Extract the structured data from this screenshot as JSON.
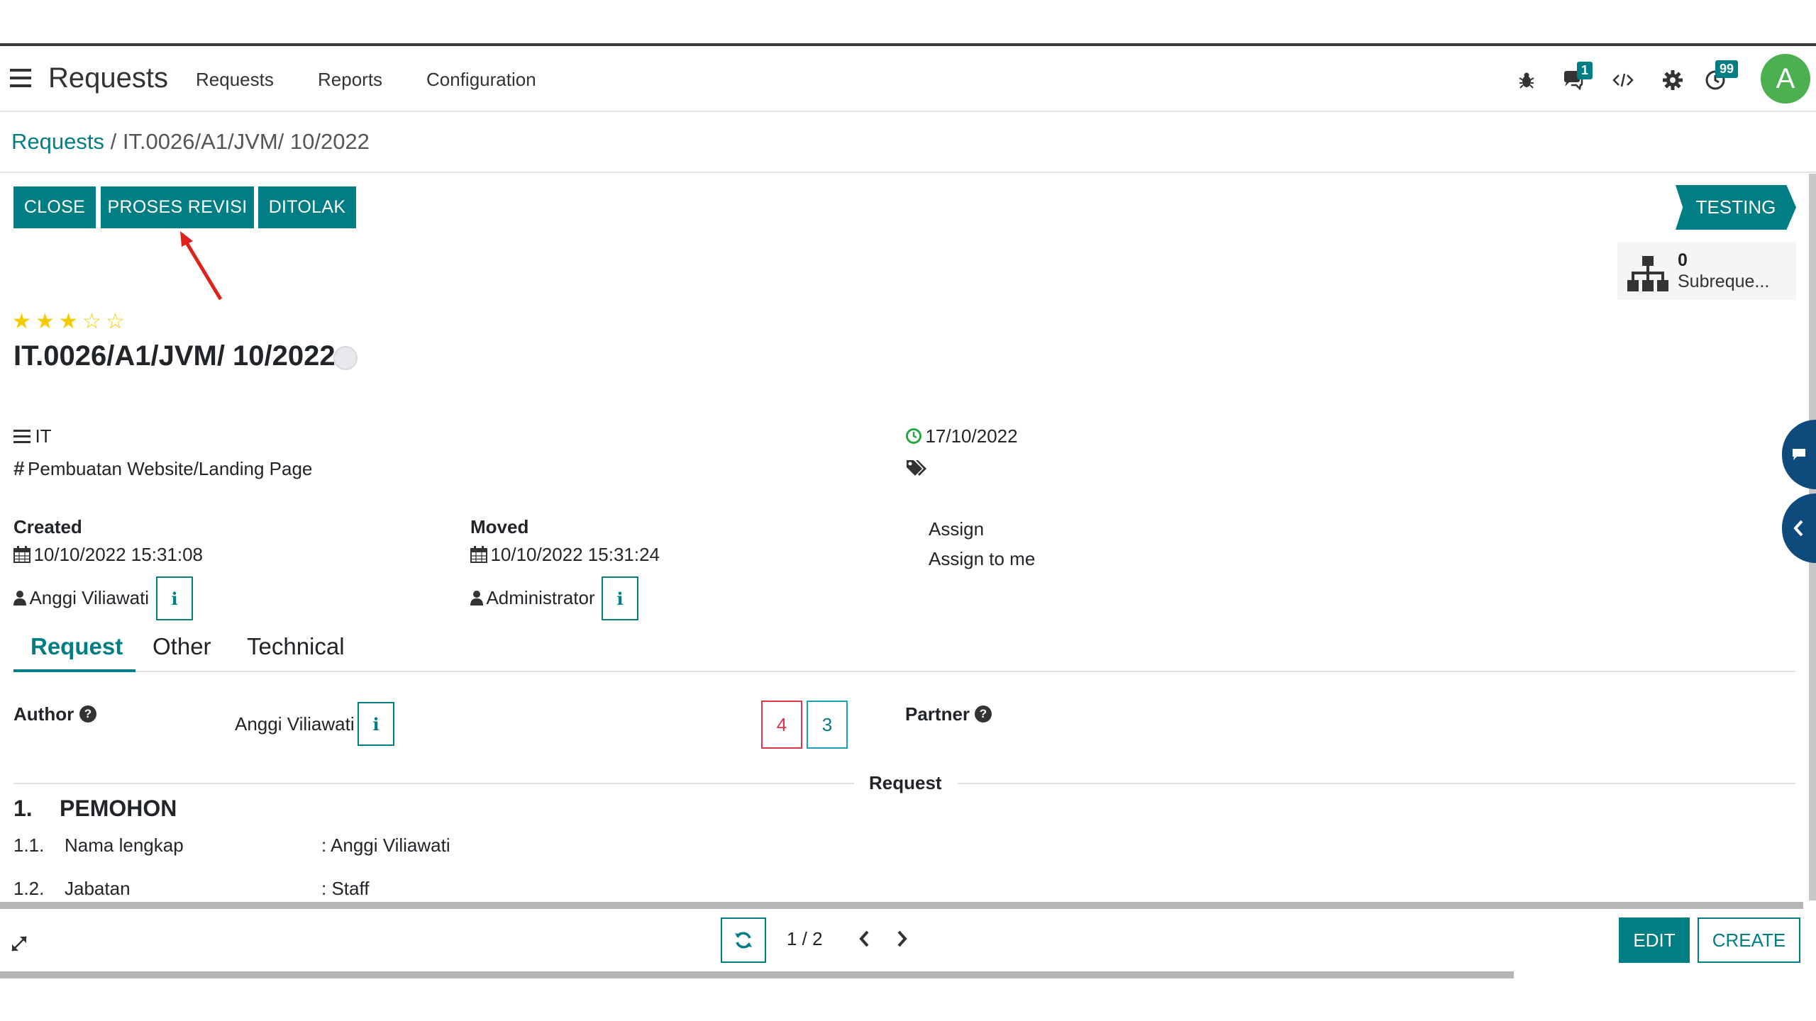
{
  "navbar": {
    "app_title": "Requests",
    "menu": [
      "Requests",
      "Reports",
      "Configuration"
    ],
    "chat_badge": "1",
    "activity_badge": "99",
    "avatar_letter": "A",
    "icons": [
      "menu-icon",
      "bug-icon",
      "chat-icon",
      "code-icon",
      "gear-icon",
      "clock-icon"
    ]
  },
  "breadcrumb": {
    "root": "Requests",
    "separator": " / ",
    "current": "IT.0026/A1/JVM/ 10/2022"
  },
  "actions": {
    "close": "CLOSE",
    "proses_revisi": "PROSES REVISI",
    "ditolak": "DITOLAK"
  },
  "status": "TESTING",
  "smart_button": {
    "count": "0",
    "label": "Subreque..."
  },
  "record": {
    "priority_stars": 3,
    "priority_max": 5,
    "title": "IT.0026/A1/JVM/ 10/2022",
    "category": "IT",
    "type": "Pembuatan Website/Landing Page",
    "deadline": "17/10/2022",
    "created_label": "Created",
    "created_date": "10/10/2022 15:31:08",
    "created_by": "Anggi Viliawati",
    "moved_label": "Moved",
    "moved_date": "10/10/2022 15:31:24",
    "moved_by": "Administrator",
    "assign": "Assign",
    "assign_to_me": "Assign to me",
    "info_glyph": "i"
  },
  "tabs": [
    "Request",
    "Other",
    "Technical"
  ],
  "request_tab": {
    "author_label": "Author",
    "author_value": "Anggi Viliawati",
    "count_red": "4",
    "count_teal": "3",
    "partner_label": "Partner",
    "separator_label": "Request",
    "section_num": "1.",
    "section_title": "PEMOHON",
    "rows": [
      {
        "num": "1.1.",
        "label": "Nama lengkap",
        "value": ": Anggi Viliawati"
      },
      {
        "num": "1.2.",
        "label": "Jabatan",
        "value": ": Staff"
      }
    ]
  },
  "pager": {
    "text": "1 / 2"
  },
  "bottom": {
    "edit": "EDIT",
    "create": "CREATE"
  },
  "colors": {
    "accent": "#017e84",
    "red": "#dc3545",
    "star": "#f3cc00",
    "avatar": "#4caf50",
    "side_tab": "#0f4a7c"
  }
}
